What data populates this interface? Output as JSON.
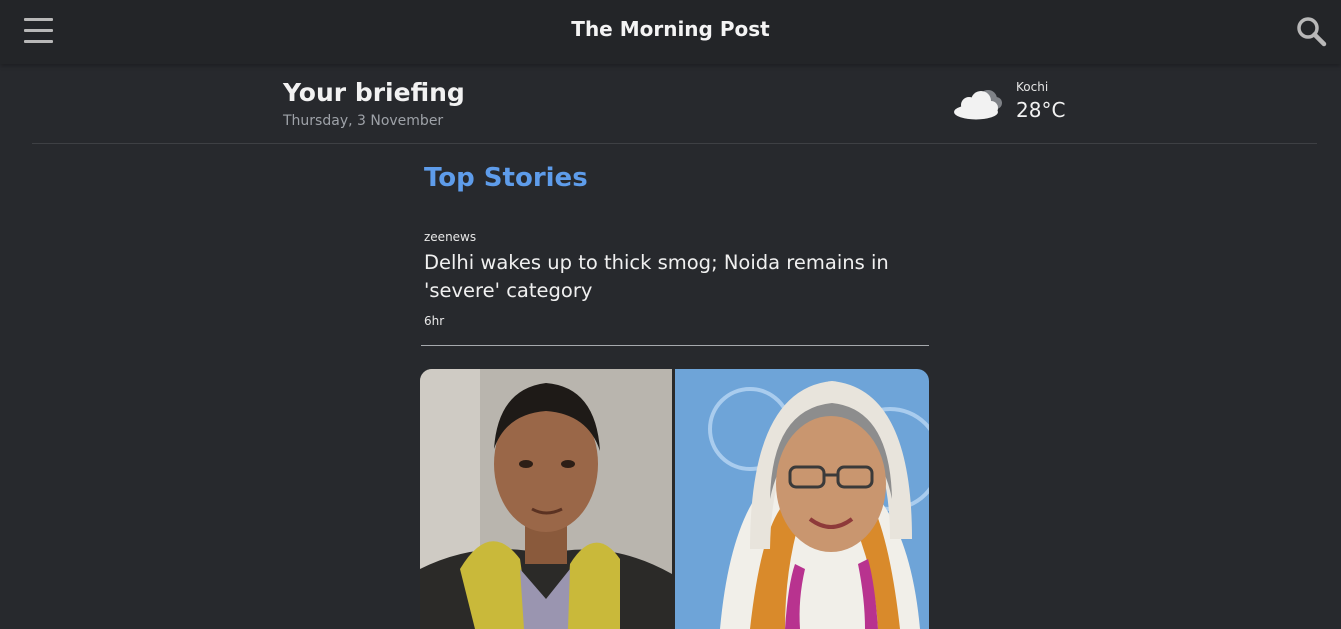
{
  "header": {
    "title": "The Morning Post",
    "menu_icon": "hamburger-menu-icon",
    "search_icon": "search-icon"
  },
  "briefing": {
    "title": "Your briefing",
    "date": "Thursday, 3 November"
  },
  "weather": {
    "city": "Kochi",
    "temperature": "28°C",
    "icon": "cloudy-icon"
  },
  "top_stories": {
    "heading": "Top Stories",
    "stories": [
      {
        "source": "zeenews",
        "headline": "Delhi wakes up to thick smog; Noida remains in 'severe' category",
        "time": "6hr"
      }
    ]
  },
  "colors": {
    "background": "#27292d",
    "topbar": "#232528",
    "accent": "#5e9cea"
  }
}
